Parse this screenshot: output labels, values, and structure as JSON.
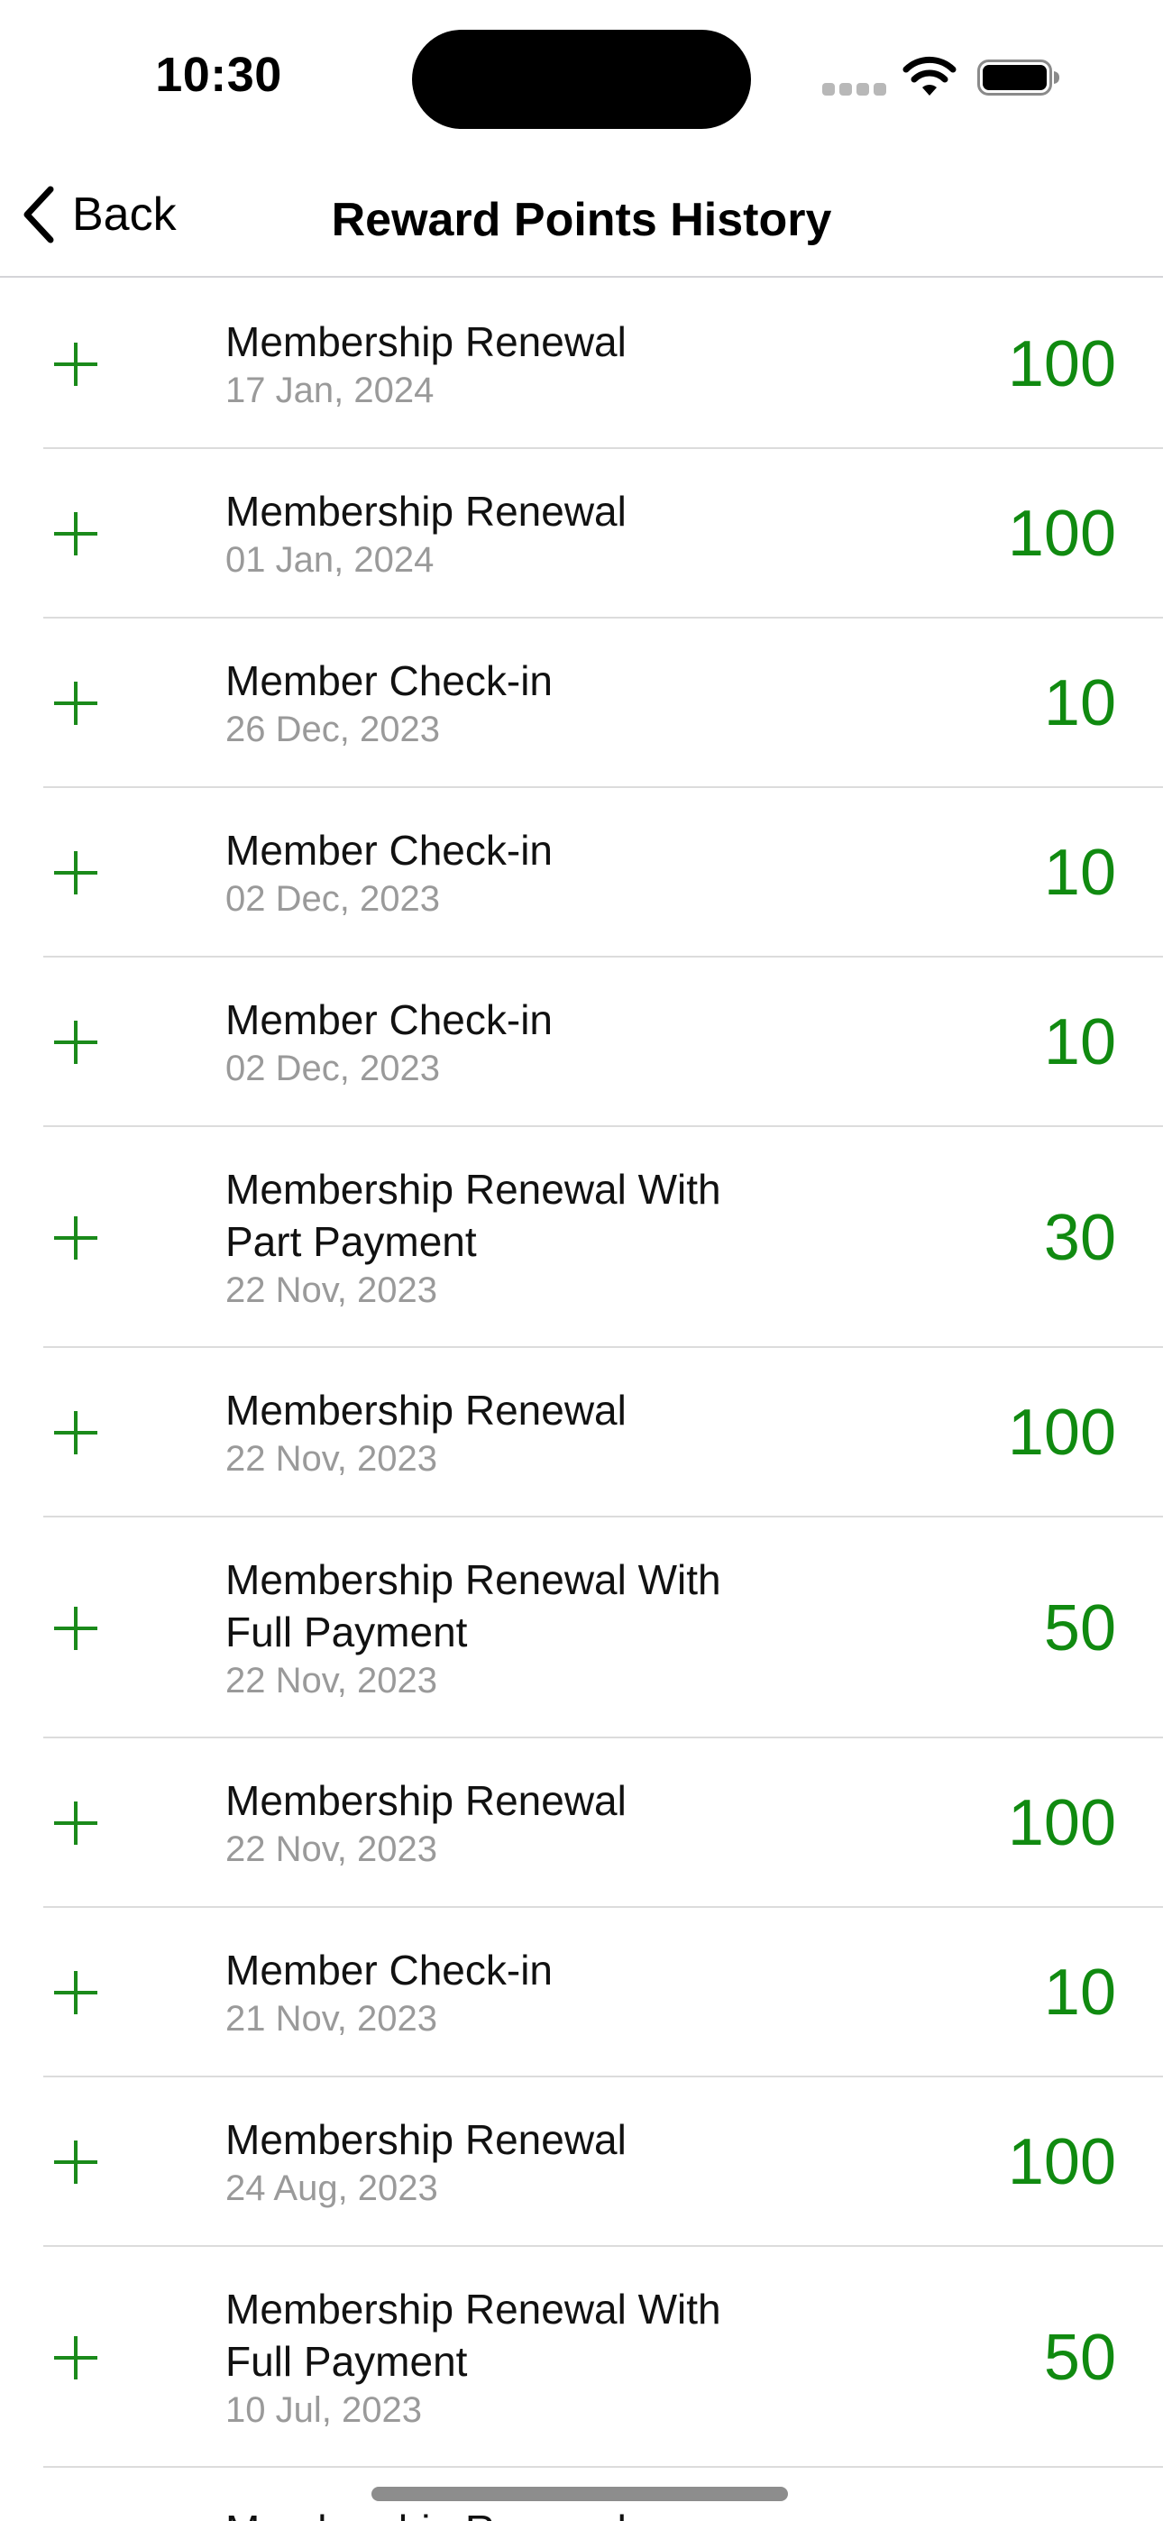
{
  "status_bar": {
    "time": "10:30",
    "icons": [
      "cellular-signal-icon",
      "wifi-icon",
      "battery-icon"
    ]
  },
  "nav": {
    "back_label": "Back",
    "back_icon": "chevron-left-icon",
    "title": "Reward Points History"
  },
  "colors": {
    "accent_green": "#108a10",
    "date_gray": "#9a9a9a",
    "separator": "#dcdcdc"
  },
  "history": [
    {
      "title": "Membership Renewal",
      "date": "17 Jan, 2024",
      "points": "100",
      "icon": "plus-icon"
    },
    {
      "title": "Membership Renewal",
      "date": "01 Jan, 2024",
      "points": "100",
      "icon": "plus-icon"
    },
    {
      "title": "Member Check-in",
      "date": "26 Dec, 2023",
      "points": "10",
      "icon": "plus-icon"
    },
    {
      "title": "Member Check-in",
      "date": "02 Dec, 2023",
      "points": "10",
      "icon": "plus-icon"
    },
    {
      "title": "Member Check-in",
      "date": "02 Dec, 2023",
      "points": "10",
      "icon": "plus-icon"
    },
    {
      "title": "Membership Renewal With Part Payment",
      "date": "22 Nov, 2023",
      "points": "30",
      "icon": "plus-icon"
    },
    {
      "title": "Membership Renewal",
      "date": "22 Nov, 2023",
      "points": "100",
      "icon": "plus-icon"
    },
    {
      "title": "Membership Renewal With Full Payment",
      "date": "22 Nov, 2023",
      "points": "50",
      "icon": "plus-icon"
    },
    {
      "title": "Membership Renewal",
      "date": "22 Nov, 2023",
      "points": "100",
      "icon": "plus-icon"
    },
    {
      "title": "Member Check-in",
      "date": "21 Nov, 2023",
      "points": "10",
      "icon": "plus-icon"
    },
    {
      "title": "Membership Renewal",
      "date": "24 Aug, 2023",
      "points": "100",
      "icon": "plus-icon"
    },
    {
      "title": "Membership Renewal With Full Payment",
      "date": "10 Jul, 2023",
      "points": "50",
      "icon": "plus-icon"
    },
    {
      "title": "Membership Renewal",
      "date": "",
      "points": "",
      "icon": "plus-icon"
    }
  ]
}
